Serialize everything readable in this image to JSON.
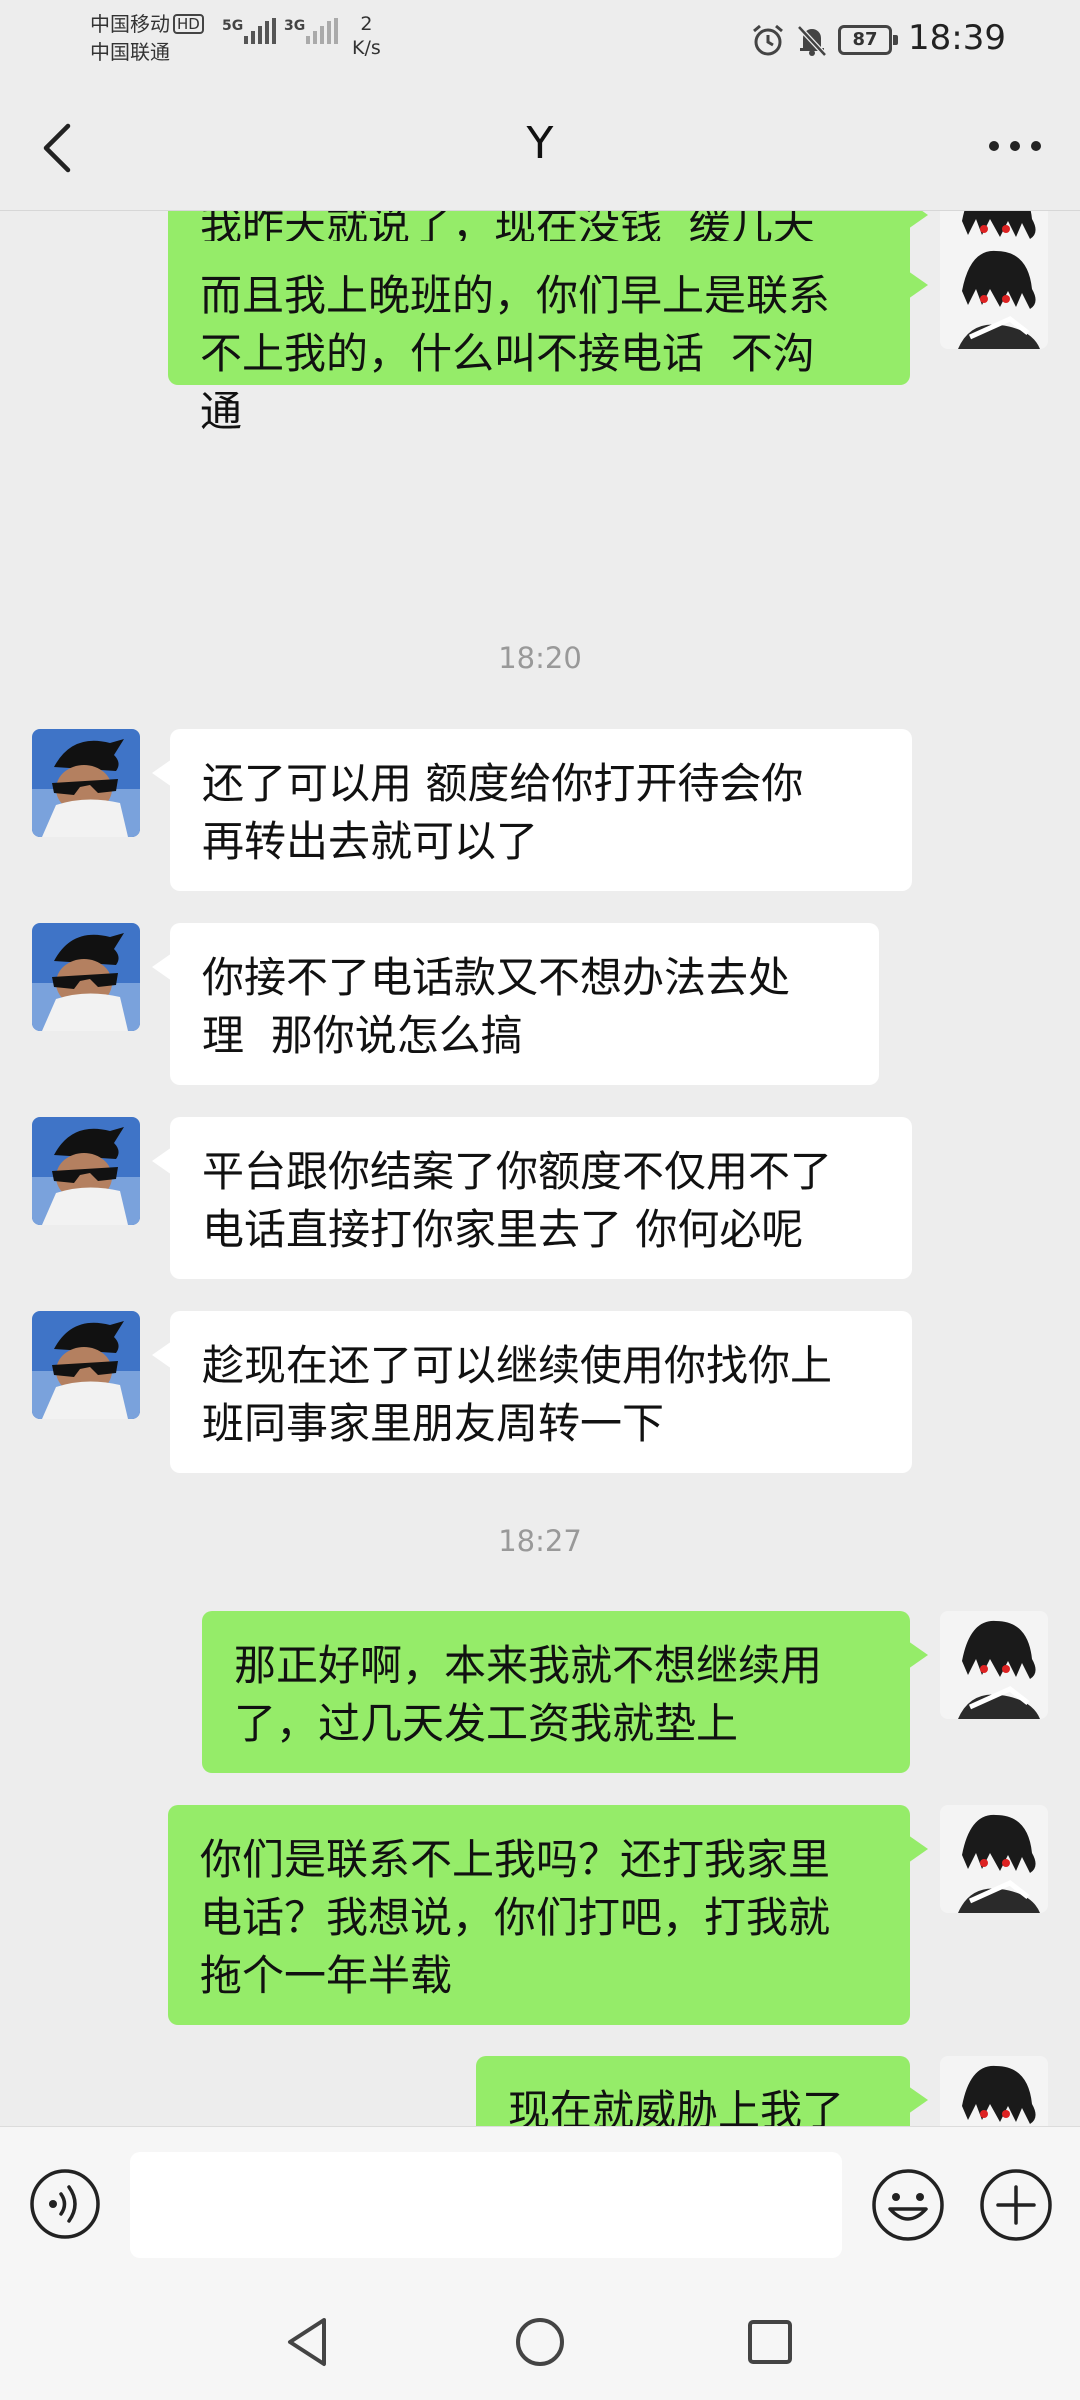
{
  "status_bar": {
    "carrier1": "中国移动",
    "carrier1_badge": "HD",
    "carrier2": "中国联通",
    "signal1_label": "5G",
    "signal2_label": "3G",
    "net_speed_value": "2",
    "net_speed_unit": "K/s",
    "battery": "87",
    "time": "18:39",
    "icons": [
      "alarm-icon",
      "mute-icon",
      "battery-icon"
    ]
  },
  "header": {
    "title": "Y",
    "back_icon": "chevron-left-icon",
    "more_icon": "more-dots-icon"
  },
  "messages": [
    {
      "sender": "me",
      "text": "我昨天就说了，现在没钱  缓几天\n再处理"
    },
    {
      "sender": "me",
      "text": "而且我上晚班的，你们早上是联系\n不上我的，什么叫不接电话  不沟\n通"
    },
    {
      "type": "timestamp",
      "text": "18:20"
    },
    {
      "sender": "them",
      "text": "还了可以用 额度给你打开待会你\n再转出去就可以了"
    },
    {
      "sender": "them",
      "text": "你接不了电话款又不想办法去处\n理  那你说怎么搞"
    },
    {
      "sender": "them",
      "text": "平台跟你结案了你额度不仅用不了\n电话直接打你家里去了 你何必呢"
    },
    {
      "sender": "them",
      "text": "趁现在还了可以继续使用你找你上\n班同事家里朋友周转一下"
    },
    {
      "type": "timestamp",
      "text": "18:27"
    },
    {
      "sender": "me",
      "text": "那正好啊，本来我就不想继续用\n了，过几天发工资我就垫上"
    },
    {
      "sender": "me",
      "text": "你们是联系不上我吗？还打我家里\n电话？我想说，你们打吧，打我就\n拖个一年半载"
    },
    {
      "sender": "me",
      "text": "现在就威胁上我了"
    }
  ],
  "input_bar": {
    "voice_icon": "voice-icon",
    "emoji_icon": "emoji-icon",
    "plus_icon": "plus-icon",
    "placeholder": "",
    "value": ""
  },
  "nav_bar": {
    "icons": [
      "nav-back-icon",
      "nav-home-icon",
      "nav-recent-icon"
    ]
  },
  "colors": {
    "background": "#ededed",
    "my_bubble": "#95ec69",
    "their_bubble": "#ffffff",
    "timestamp": "#999999"
  }
}
